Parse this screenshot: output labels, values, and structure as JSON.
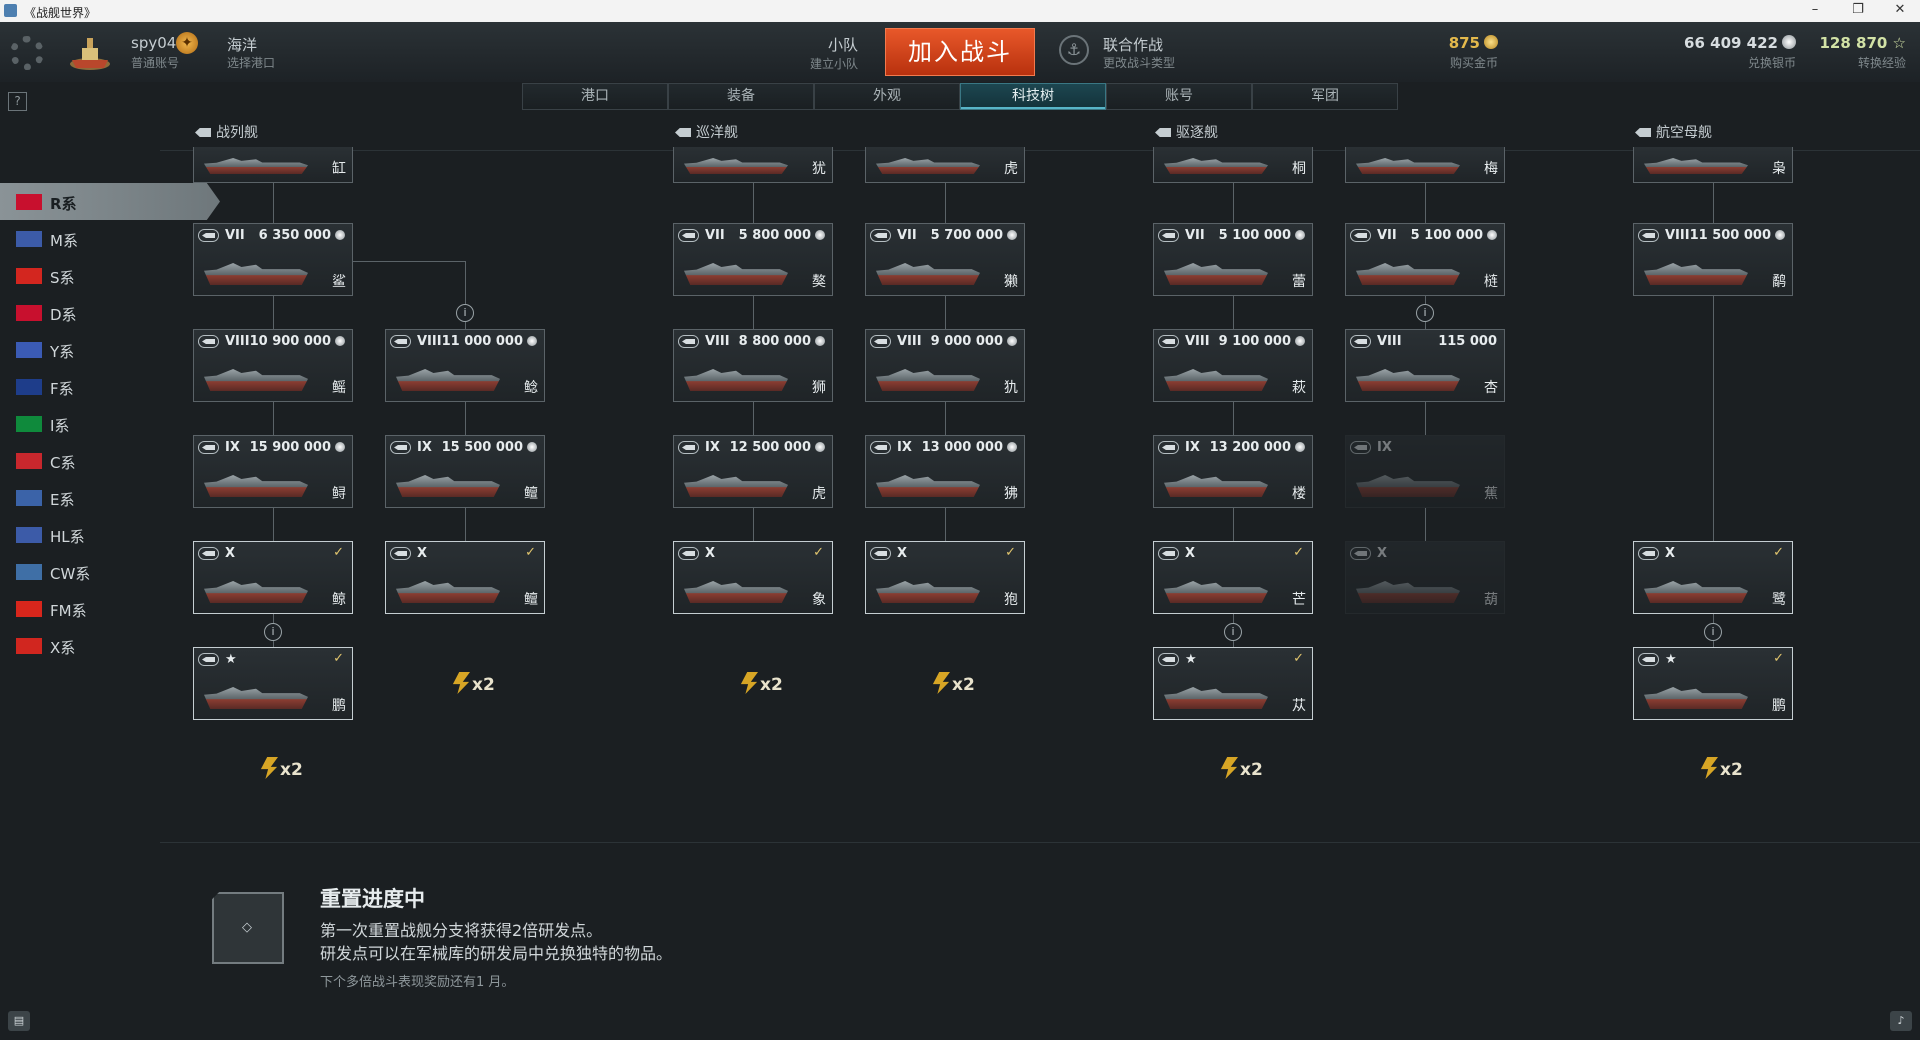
{
  "window": {
    "title": "《战舰世界》",
    "controls": [
      "–",
      "❐",
      "✕"
    ]
  },
  "user": {
    "name": "spy04",
    "account": "普通账号",
    "badge": "✦"
  },
  "port": {
    "name": "海洋",
    "label": "选择港口"
  },
  "squad": {
    "title": "小队",
    "label": "建立小队"
  },
  "battle_button": "加入战斗",
  "mode": {
    "title": "联合作战",
    "label": "更改战斗类型"
  },
  "currencies": [
    {
      "value": "875",
      "label": "购买金币",
      "color": "#e3b94c"
    },
    {
      "value": "66 409 422",
      "label": "兑换银币",
      "color": "#d7dde0"
    },
    {
      "value": "128 870 ☆",
      "label": "转换经验",
      "color": "#d2e2a6"
    }
  ],
  "tabs": [
    "港口",
    "装备",
    "外观",
    "科技树",
    "账号",
    "军团"
  ],
  "active_tab": 3,
  "class_headers": [
    "战列舰",
    "巡洋舰",
    "驱逐舰",
    "航空母舰"
  ],
  "nations": [
    "R系",
    "M系",
    "S系",
    "D系",
    "Y系",
    "F系",
    "I系",
    "C系",
    "E系",
    "HL系",
    "CW系",
    "FM系",
    "X系"
  ],
  "active_nation": 0,
  "ships": {
    "bb_a": [
      {
        "tier": "",
        "price": "",
        "name": "缸"
      },
      {
        "tier": "VII",
        "price": "6 350 000",
        "name": "鲨"
      },
      {
        "tier": "VIII",
        "price": "10 900 000",
        "name": "鳐"
      },
      {
        "tier": "IX",
        "price": "15 900 000",
        "name": "鲟"
      },
      {
        "tier": "X",
        "price": "",
        "name": "鲸"
      },
      {
        "tier": "★",
        "price": "",
        "name": "鹏"
      }
    ],
    "bb_b": [
      {
        "tier": "VIII",
        "price": "11 000 000",
        "name": "鲶"
      },
      {
        "tier": "IX",
        "price": "15 500 000",
        "name": "鳣"
      },
      {
        "tier": "X",
        "price": "",
        "name": "鳣"
      }
    ],
    "ca_a": [
      {
        "tier": "",
        "price": "",
        "name": "犹"
      },
      {
        "tier": "VII",
        "price": "5 800 000",
        "name": "獒"
      },
      {
        "tier": "VIII",
        "price": "8 800 000",
        "name": "狮"
      },
      {
        "tier": "IX",
        "price": "12 500 000",
        "name": "虎"
      },
      {
        "tier": "X",
        "price": "",
        "name": "象"
      }
    ],
    "ca_b": [
      {
        "tier": "",
        "price": "",
        "name": "虎"
      },
      {
        "tier": "VII",
        "price": "5 700 000",
        "name": "獭"
      },
      {
        "tier": "VIII",
        "price": "9 000 000",
        "name": "犰"
      },
      {
        "tier": "IX",
        "price": "13 000 000",
        "name": "狒"
      },
      {
        "tier": "X",
        "price": "",
        "name": "狍"
      }
    ],
    "dd_a": [
      {
        "tier": "",
        "price": "",
        "name": "桐"
      },
      {
        "tier": "VII",
        "price": "5 100 000",
        "name": "蕾"
      },
      {
        "tier": "VIII",
        "price": "9 100 000",
        "name": "萩"
      },
      {
        "tier": "IX",
        "price": "13 200 000",
        "name": "楼"
      },
      {
        "tier": "X",
        "price": "",
        "name": "芒"
      },
      {
        "tier": "★",
        "price": "",
        "name": "苁"
      }
    ],
    "dd_b": [
      {
        "tier": "",
        "price": "",
        "name": "梅"
      },
      {
        "tier": "VII",
        "price": "5 100 000",
        "name": "梿"
      },
      {
        "tier": "VIII",
        "price": "115 000",
        "name": "杏"
      },
      {
        "tier": "IX",
        "price": "",
        "name": "蕉"
      },
      {
        "tier": "X",
        "price": "",
        "name": "葫"
      }
    ],
    "cv": [
      {
        "tier": "",
        "price": "",
        "name": "枭"
      },
      {
        "tier": "VIII",
        "price": "11 500 000",
        "name": "鹬"
      },
      {
        "tier": "X",
        "price": "",
        "name": "鹭"
      },
      {
        "tier": "★",
        "price": "",
        "name": "鹏"
      }
    ]
  },
  "bonus_label": "x2",
  "reset": {
    "title": "重置进度中",
    "line1": "第一次重置战舰分支将获得2倍研发点。",
    "line2": "研发点可以在军械库的研发局中兑换独特的物品。",
    "line3": "下个多倍战斗表现奖励还有1 月。"
  }
}
